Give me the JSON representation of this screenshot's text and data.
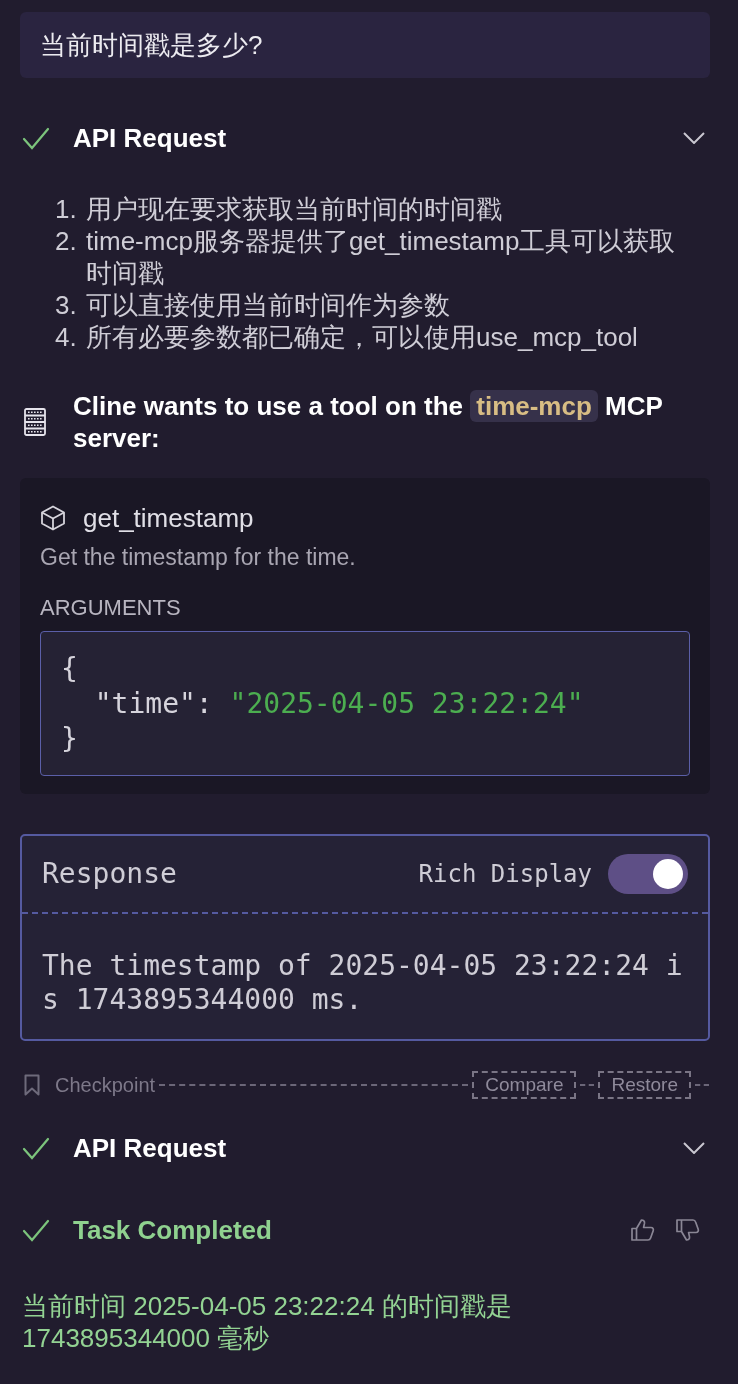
{
  "messages": [
    {
      "kind": "user",
      "text": "当前时间戳是多少?"
    },
    {
      "kind": "api_request",
      "title": "API Request",
      "done": true,
      "expanded": false
    },
    {
      "kind": "reasoning",
      "items": [
        {
          "number": "1.",
          "text": "用户现在要求获取当前时间的时间戳"
        },
        {
          "number": "2.",
          "text": "time-mcp服务器提供了get_timestamp工具可以获取时间戳"
        },
        {
          "number": "3.",
          "text": "可以直接使用当前时间作为参数"
        },
        {
          "number": "4.",
          "text": "所有必要参数都已确定，可以使用use_mcp_tool"
        }
      ]
    },
    {
      "kind": "tool_request",
      "before": "Cline wants to use a tool on the",
      "server": "time-mcp",
      "after": "MCP server:",
      "tool": {
        "name": "get_timestamp",
        "description": "Get the timestamp for the time.",
        "arguments_label": "ARGUMENTS",
        "code_lines": [
          [
            {
              "kind": "plain",
              "text": "{"
            }
          ],
          [
            {
              "kind": "plain",
              "text": "  \"time\": "
            },
            {
              "kind": "string",
              "text": "\"2025-04-05 23:22:24\""
            }
          ],
          [
            {
              "kind": "plain",
              "text": "}"
            }
          ]
        ]
      }
    },
    {
      "kind": "response",
      "title": "Response",
      "rich_display": {
        "label": "Rich Display",
        "on": true
      },
      "text": "The timestamp of 2025-04-05 23:22:24 is 1743895344000 ms."
    },
    {
      "kind": "checkpoint",
      "label": "Checkpoint",
      "buttons": [
        "Compare",
        "Restore"
      ]
    },
    {
      "kind": "api_request",
      "title": "API Request",
      "done": true,
      "expanded": false
    },
    {
      "kind": "completion",
      "title": "Task Completed",
      "done": true,
      "text": "当前时间 2025-04-05 23:22:24 的时间戳是 1743895344000 毫秒"
    }
  ]
}
